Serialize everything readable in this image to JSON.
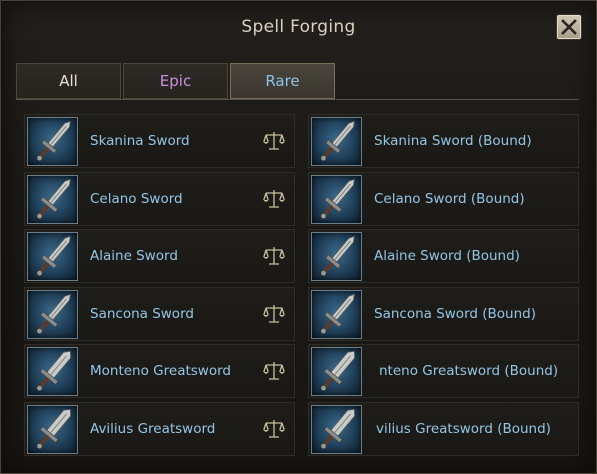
{
  "window": {
    "title": "Spell Forging"
  },
  "tabs": [
    {
      "label": "All"
    },
    {
      "label": "Epic"
    },
    {
      "label": "Rare"
    }
  ],
  "active_tab": "Rare",
  "colors": {
    "rare_text": "#93c6e6",
    "epic_text": "#c78fe0",
    "title_text": "#d9d2c2"
  },
  "items_left": [
    {
      "name": "Skanina Sword",
      "icon": "sword-icon",
      "has_scale": true
    },
    {
      "name": "Celano Sword",
      "icon": "sword-icon",
      "has_scale": true
    },
    {
      "name": "Alaine Sword",
      "icon": "sword-icon",
      "has_scale": true
    },
    {
      "name": "Sancona Sword",
      "icon": "sword-icon",
      "has_scale": true
    },
    {
      "name": "Monteno Greatsword",
      "icon": "greatsword-icon",
      "has_scale": true
    },
    {
      "name": "Avilius Greatsword",
      "icon": "greatsword-icon",
      "has_scale": true
    }
  ],
  "items_right": [
    {
      "name": "Skanina Sword (Bound)",
      "icon": "sword-icon"
    },
    {
      "name": "Celano Sword (Bound)",
      "icon": "sword-icon"
    },
    {
      "name": "Alaine Sword (Bound)",
      "icon": "sword-icon"
    },
    {
      "name": "Sancona Sword (Bound)",
      "icon": "sword-icon"
    },
    {
      "name": "nteno Greatsword (Bound)",
      "icon": "greatsword-icon"
    },
    {
      "name": "vilius Greatsword (Bound)",
      "icon": "greatsword-icon"
    }
  ]
}
